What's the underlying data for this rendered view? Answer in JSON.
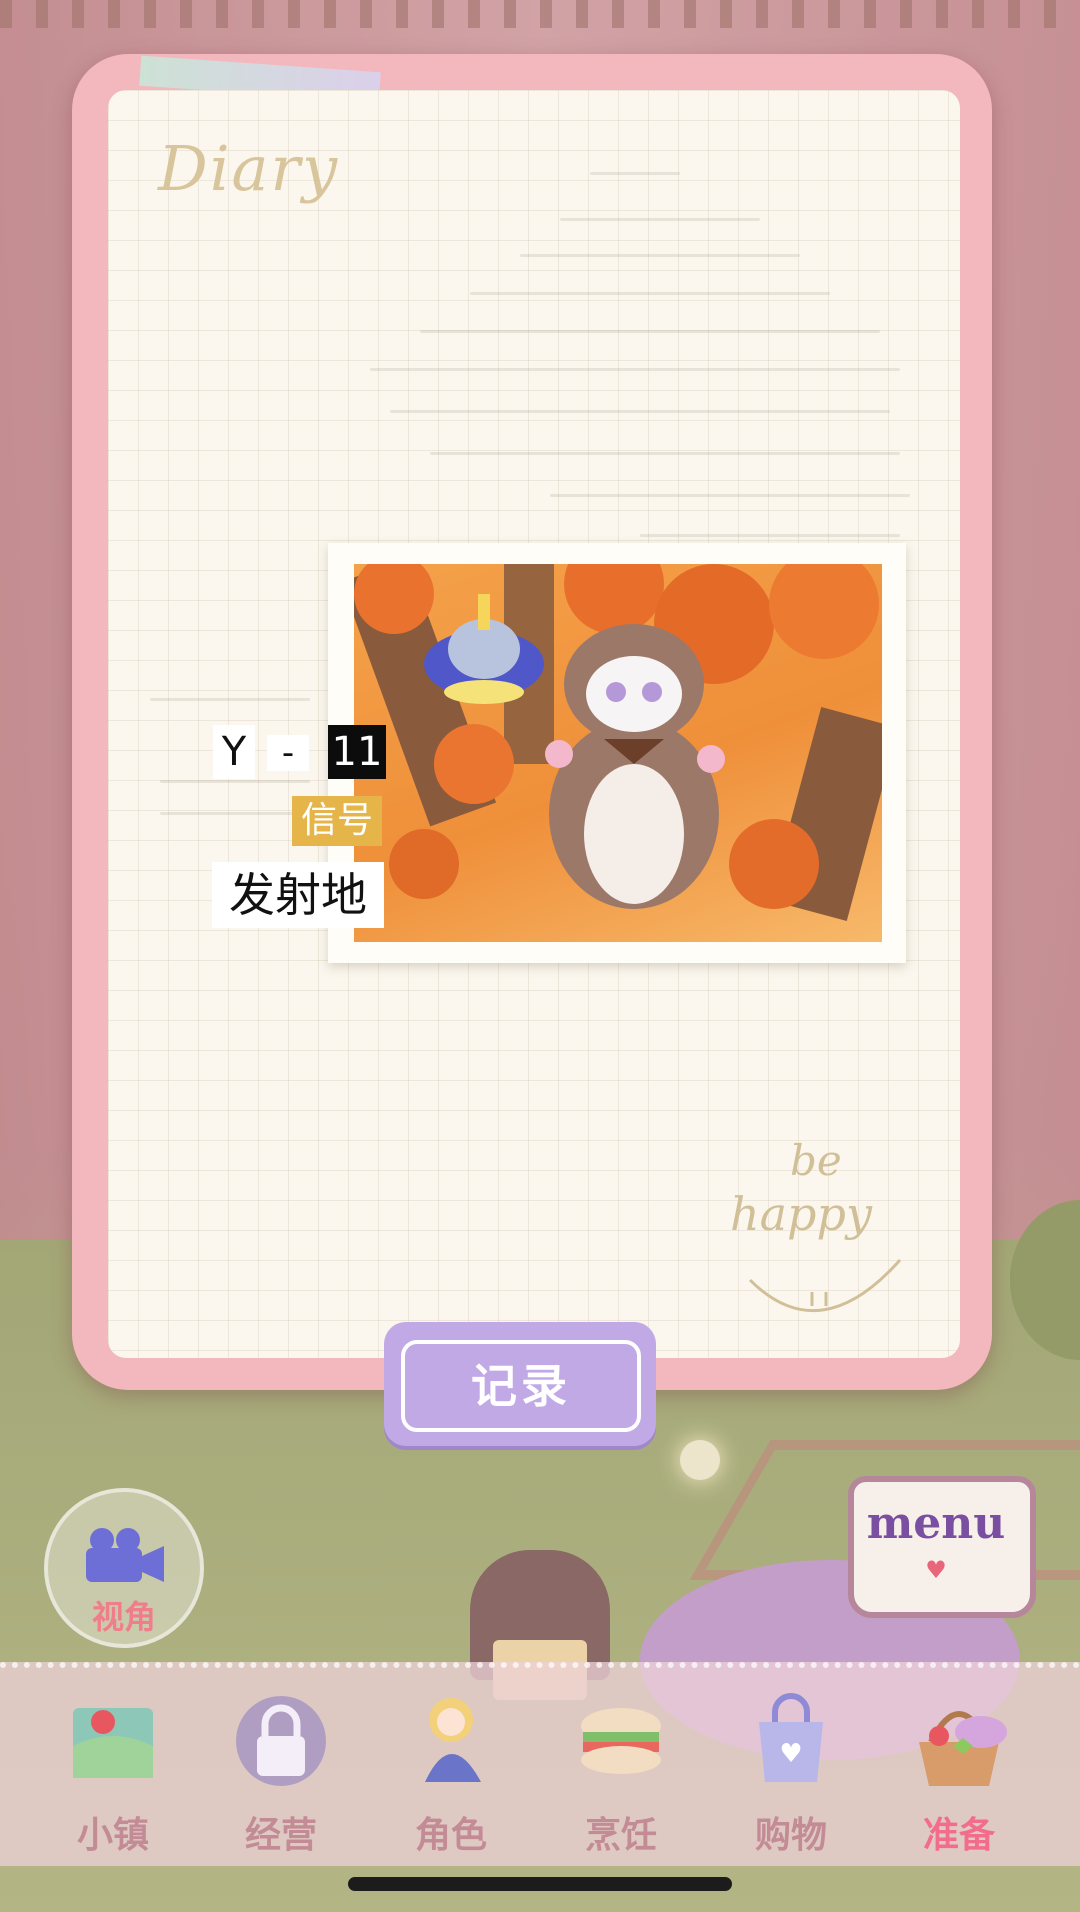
{
  "diary": {
    "title": "Diary",
    "signature": "be happy",
    "signal_tags": {
      "part1": "Y",
      "part2": "-",
      "part3": "11",
      "signal": "信号",
      "origin": "发射地"
    },
    "record_button_label": "记录"
  },
  "view_button": {
    "label": "视角",
    "icon": "video-camera-icon"
  },
  "menu_button": {
    "label": "menu",
    "icon": "book-icon"
  },
  "bottom_nav": {
    "items": [
      {
        "label": "小镇",
        "icon": "map-icon",
        "active": false
      },
      {
        "label": "经营",
        "icon": "lock-icon",
        "active": false
      },
      {
        "label": "角色",
        "icon": "character-icon",
        "active": false
      },
      {
        "label": "烹饪",
        "icon": "sandwich-icon",
        "active": false
      },
      {
        "label": "购物",
        "icon": "shopping-bag-icon",
        "active": false
      },
      {
        "label": "准备",
        "icon": "basket-icon",
        "active": true
      }
    ]
  },
  "colors": {
    "frame": "#f2b8bd",
    "record_button": "#c1a9e6",
    "nav_active": "#f26d8a",
    "nav_inactive": "#c28b95"
  }
}
